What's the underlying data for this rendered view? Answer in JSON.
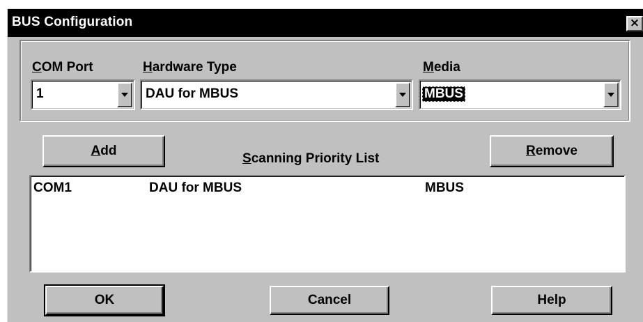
{
  "window": {
    "title": "BUS Configuration",
    "close_glyph": "×"
  },
  "com_port": {
    "label_underlined": "C",
    "label_rest": "OM Port",
    "value": "1"
  },
  "hardware_type": {
    "label_underlined": "H",
    "label_rest": "ardware Type",
    "value": "DAU for MBUS"
  },
  "media": {
    "label_underlined": "M",
    "label_rest": "edia",
    "value": "MBUS"
  },
  "buttons": {
    "add": {
      "underlined": "A",
      "rest": "dd"
    },
    "remove": {
      "underlined": "R",
      "rest": "emove"
    },
    "ok": "OK",
    "cancel": "Cancel",
    "help": "Help"
  },
  "priority_list": {
    "label_underlined": "S",
    "label_rest": "canning Priority List",
    "rows": [
      {
        "port": "COM1",
        "hardware": "DAU for MBUS",
        "media": "MBUS"
      }
    ]
  },
  "icons": [
    "close-icon",
    "dropdown-arrow-icon"
  ],
  "colors": {
    "dialog_bg": "#c0c0c0",
    "titlebar": "#000000",
    "selection": "#000000"
  }
}
